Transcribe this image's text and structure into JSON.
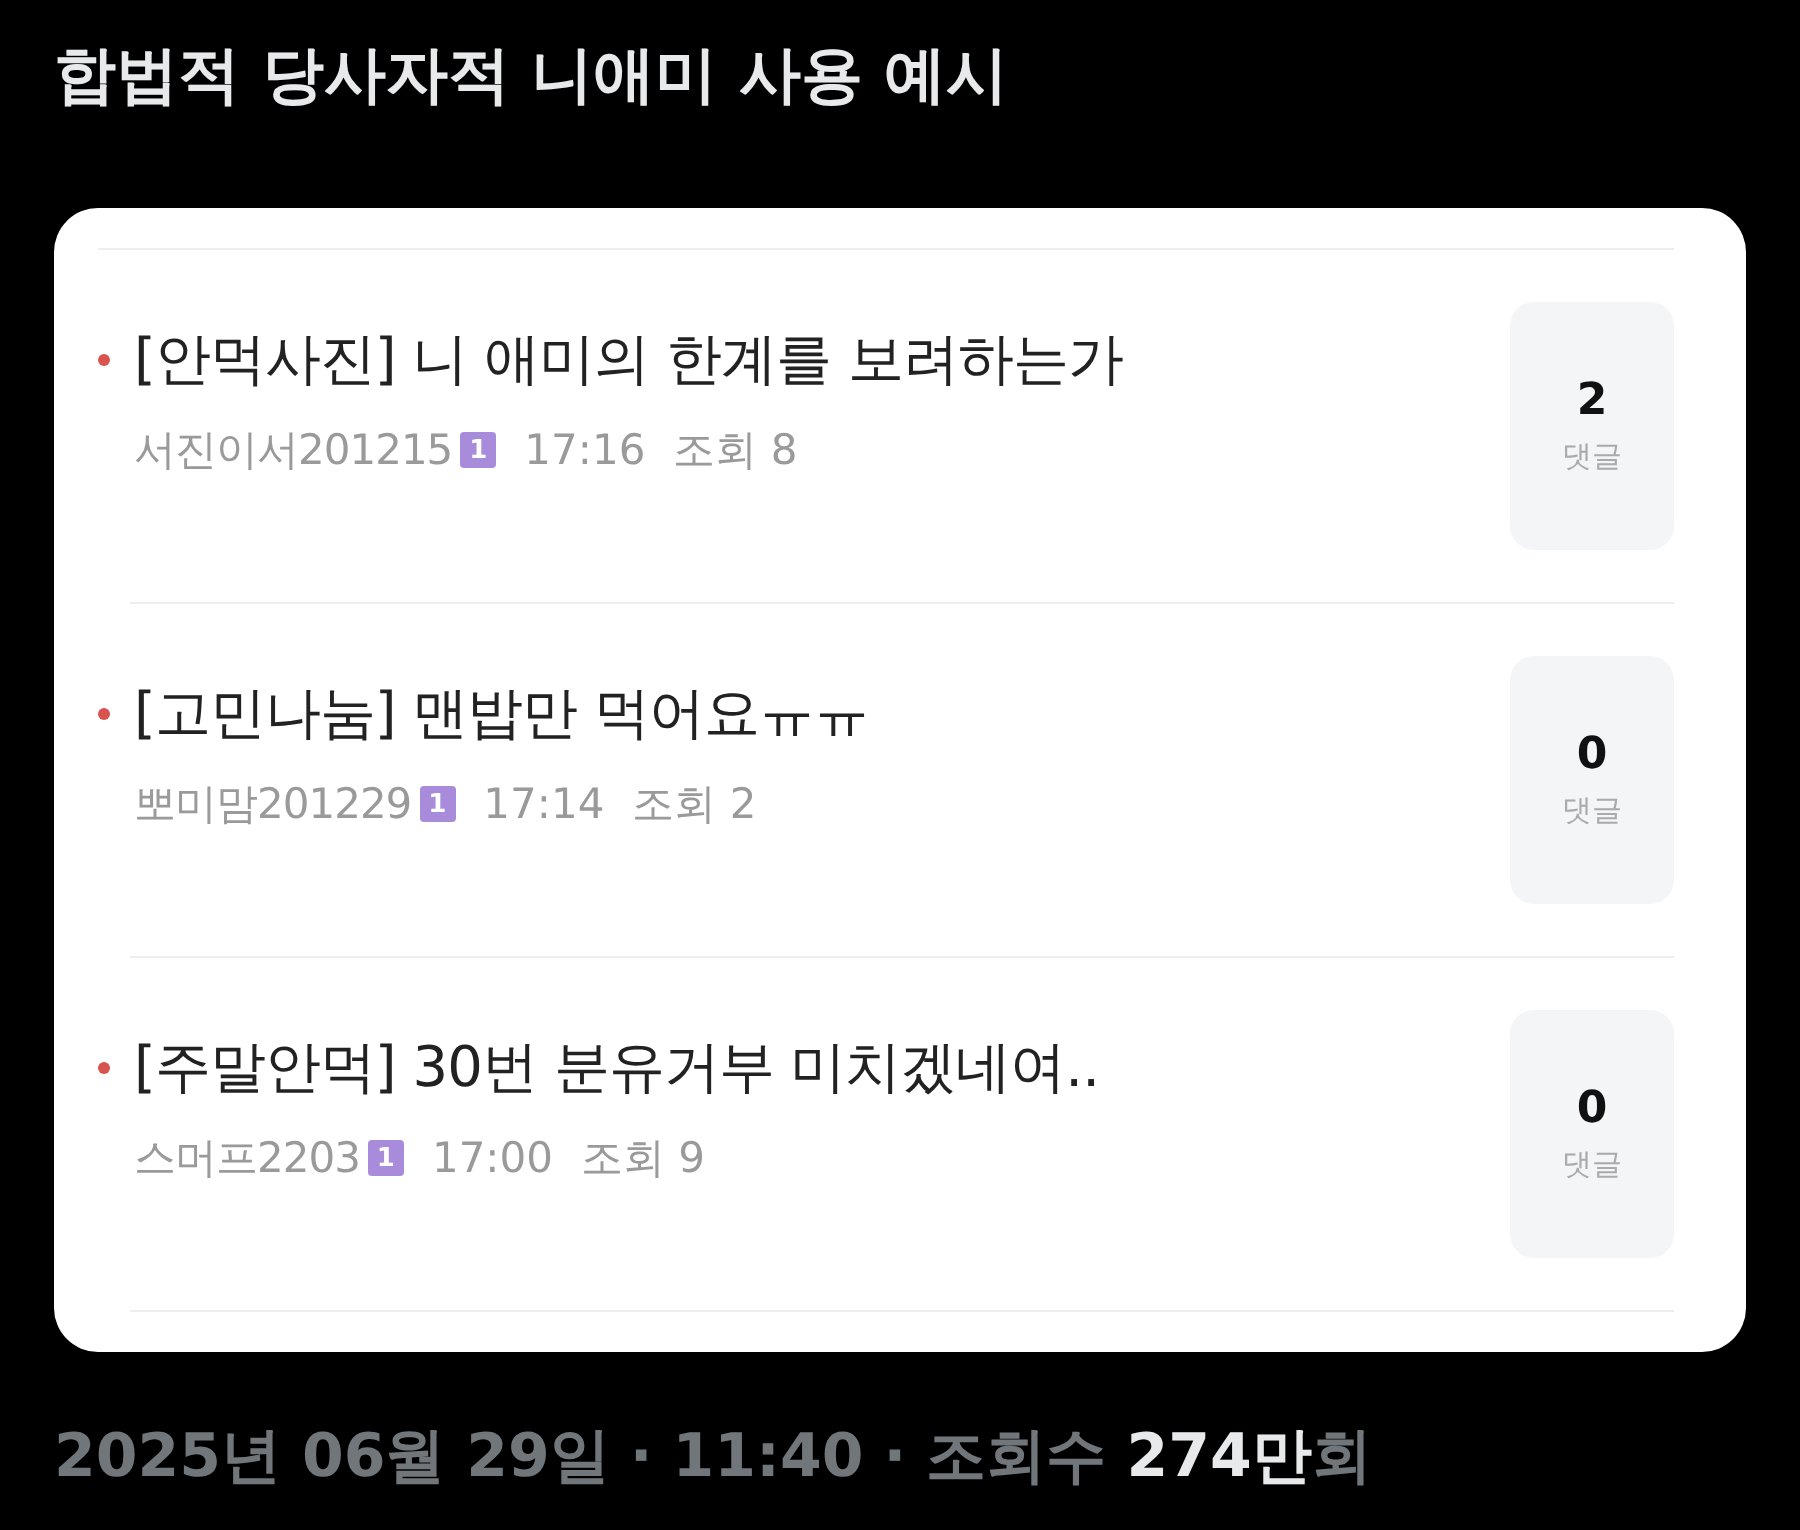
{
  "title": "합법적 당사자적 니애미 사용 예시",
  "posts": [
    {
      "title": "[안먹사진] 니 애미의 한계를 보려하는가",
      "author": "서진이서201215",
      "level_badge": "1",
      "time": "17:16",
      "views": "조회 8",
      "comments": "2",
      "comments_label": "댓글"
    },
    {
      "title": "[고민나눔] 맨밥만 먹어요ㅠㅠ",
      "author": "뽀미맘201229",
      "level_badge": "1",
      "time": "17:14",
      "views": "조회 2",
      "comments": "0",
      "comments_label": "댓글"
    },
    {
      "title": "[주말안먹] 30번 분유거부 미치겠네여..",
      "author": "스머프2203",
      "level_badge": "1",
      "time": "17:00",
      "views": "조회 9",
      "comments": "0",
      "comments_label": "댓글"
    }
  ],
  "footer": [
    {
      "text": "2025년 06월 29일",
      "kind": "meta"
    },
    {
      "text": "·",
      "kind": "sep"
    },
    {
      "text": "11:40",
      "kind": "meta"
    },
    {
      "text": "·",
      "kind": "sep"
    },
    {
      "text": "조회수",
      "kind": "meta"
    },
    {
      "text": "274만",
      "kind": "count"
    },
    {
      "text": "회",
      "kind": "unit"
    }
  ]
}
